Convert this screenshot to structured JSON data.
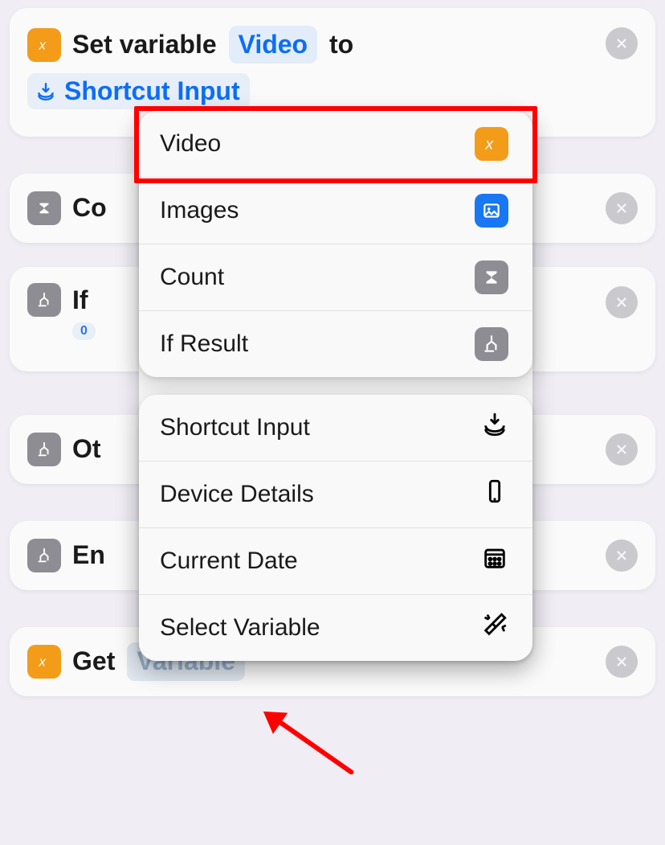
{
  "cards": {
    "set_variable": {
      "prefix": "Set variable",
      "var_name": "Video",
      "suffix": "to",
      "shortcut_input": "Shortcut Input"
    },
    "count": {
      "label": "Co"
    },
    "if": {
      "label": "If",
      "value": "0"
    },
    "otherwise": {
      "label": "Ot"
    },
    "end": {
      "label": "En"
    },
    "get": {
      "label": "Get",
      "placeholder": "Variable"
    }
  },
  "popover": {
    "group1": [
      {
        "label": "Video",
        "icon": "variable-orange"
      },
      {
        "label": "Images",
        "icon": "photo-blue"
      },
      {
        "label": "Count",
        "icon": "sigma-gray"
      },
      {
        "label": "If Result",
        "icon": "branch-gray"
      }
    ],
    "group2": [
      {
        "label": "Shortcut Input",
        "icon": "download-glyph"
      },
      {
        "label": "Device Details",
        "icon": "phone-glyph"
      },
      {
        "label": "Current Date",
        "icon": "calendar-glyph"
      },
      {
        "label": "Select Variable",
        "icon": "sparkle-glyph"
      }
    ]
  }
}
